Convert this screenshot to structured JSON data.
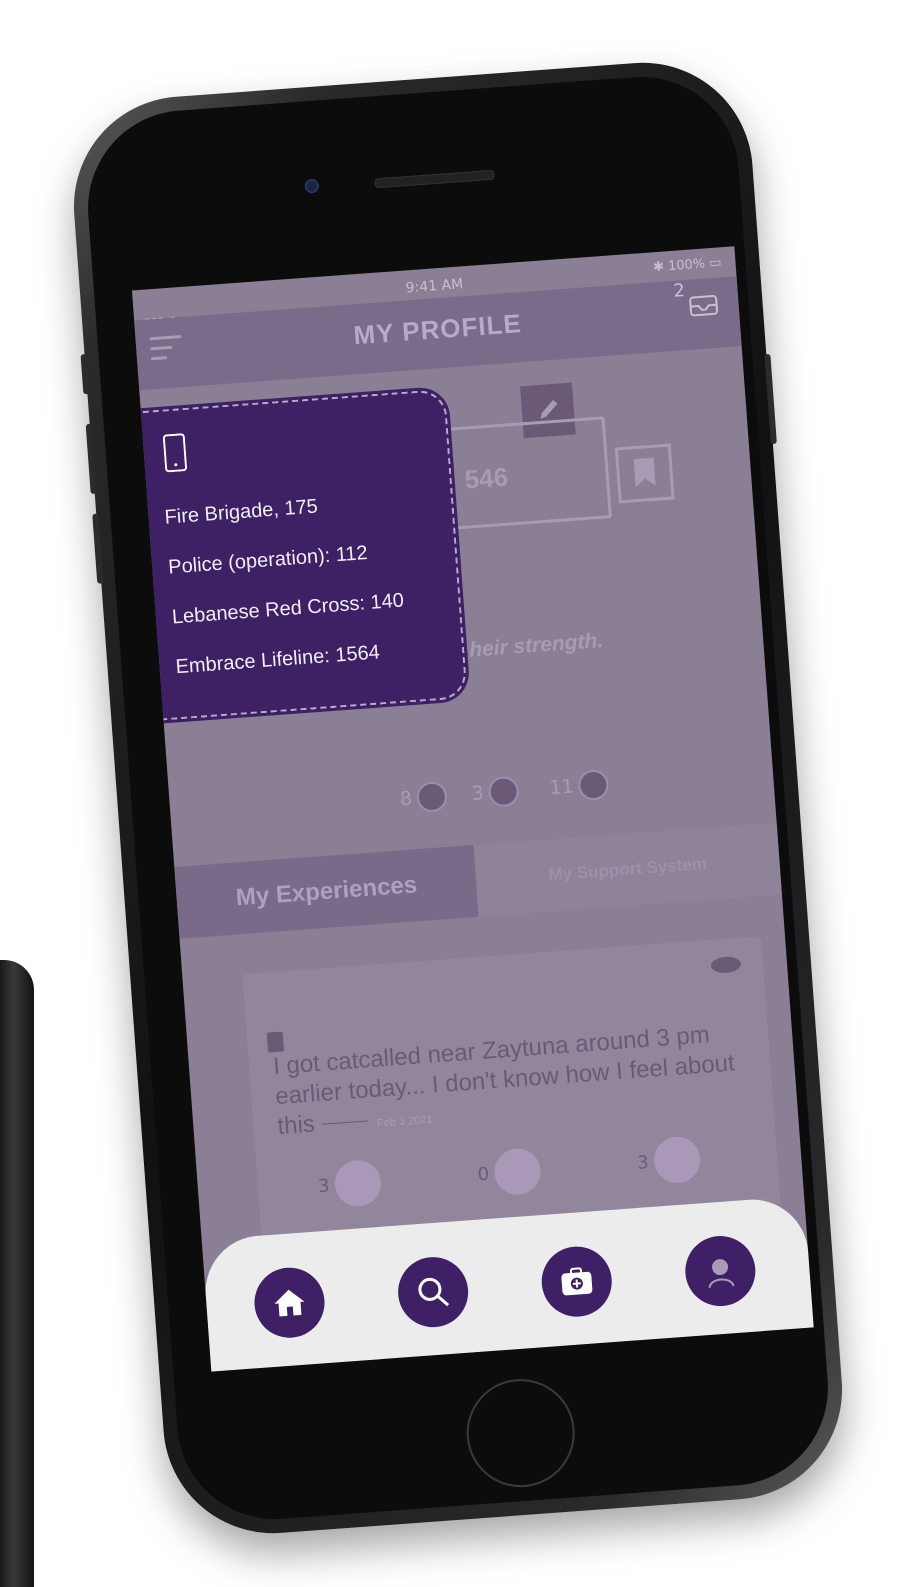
{
  "status_bar": {
    "time": "9:41 AM",
    "battery": "100%"
  },
  "header": {
    "title": "MY PROFILE",
    "inbox_count": "2"
  },
  "profile": {
    "code": "546",
    "quote": "heir strength."
  },
  "badges": [
    {
      "count": "8",
      "icon": "heart-icon"
    },
    {
      "count": "3",
      "icon": "lotus-icon"
    },
    {
      "count": "11",
      "icon": "arm-icon"
    }
  ],
  "tabs": [
    {
      "label": "My Experiences",
      "active": true
    },
    {
      "label": "My Support System",
      "active": false
    }
  ],
  "post": {
    "text": "I got catcalled near Zaytuna around 3 pm earlier today... I don't know how I feel about this",
    "date": "Feb 3 2021",
    "reactions": [
      {
        "count": "3",
        "icon": "heart-icon"
      },
      {
        "count": "0",
        "icon": "lotus-icon"
      },
      {
        "count": "3",
        "icon": "arm-icon"
      }
    ]
  },
  "emergency_popup": {
    "lines": [
      "Fire Brigade, 175",
      "Police (operation): 112",
      "Lebanese Red Cross: 140",
      "Embrace Lifeline: 1564"
    ]
  },
  "nav": {
    "items": [
      "home-icon",
      "search-icon",
      "medical-kit-icon",
      "profile-avatar-icon"
    ],
    "accent": "#3f1f66"
  },
  "colors": {
    "overlay": "#8a7f95",
    "popup": "#3d2164",
    "nav_bg": "#ececec"
  }
}
